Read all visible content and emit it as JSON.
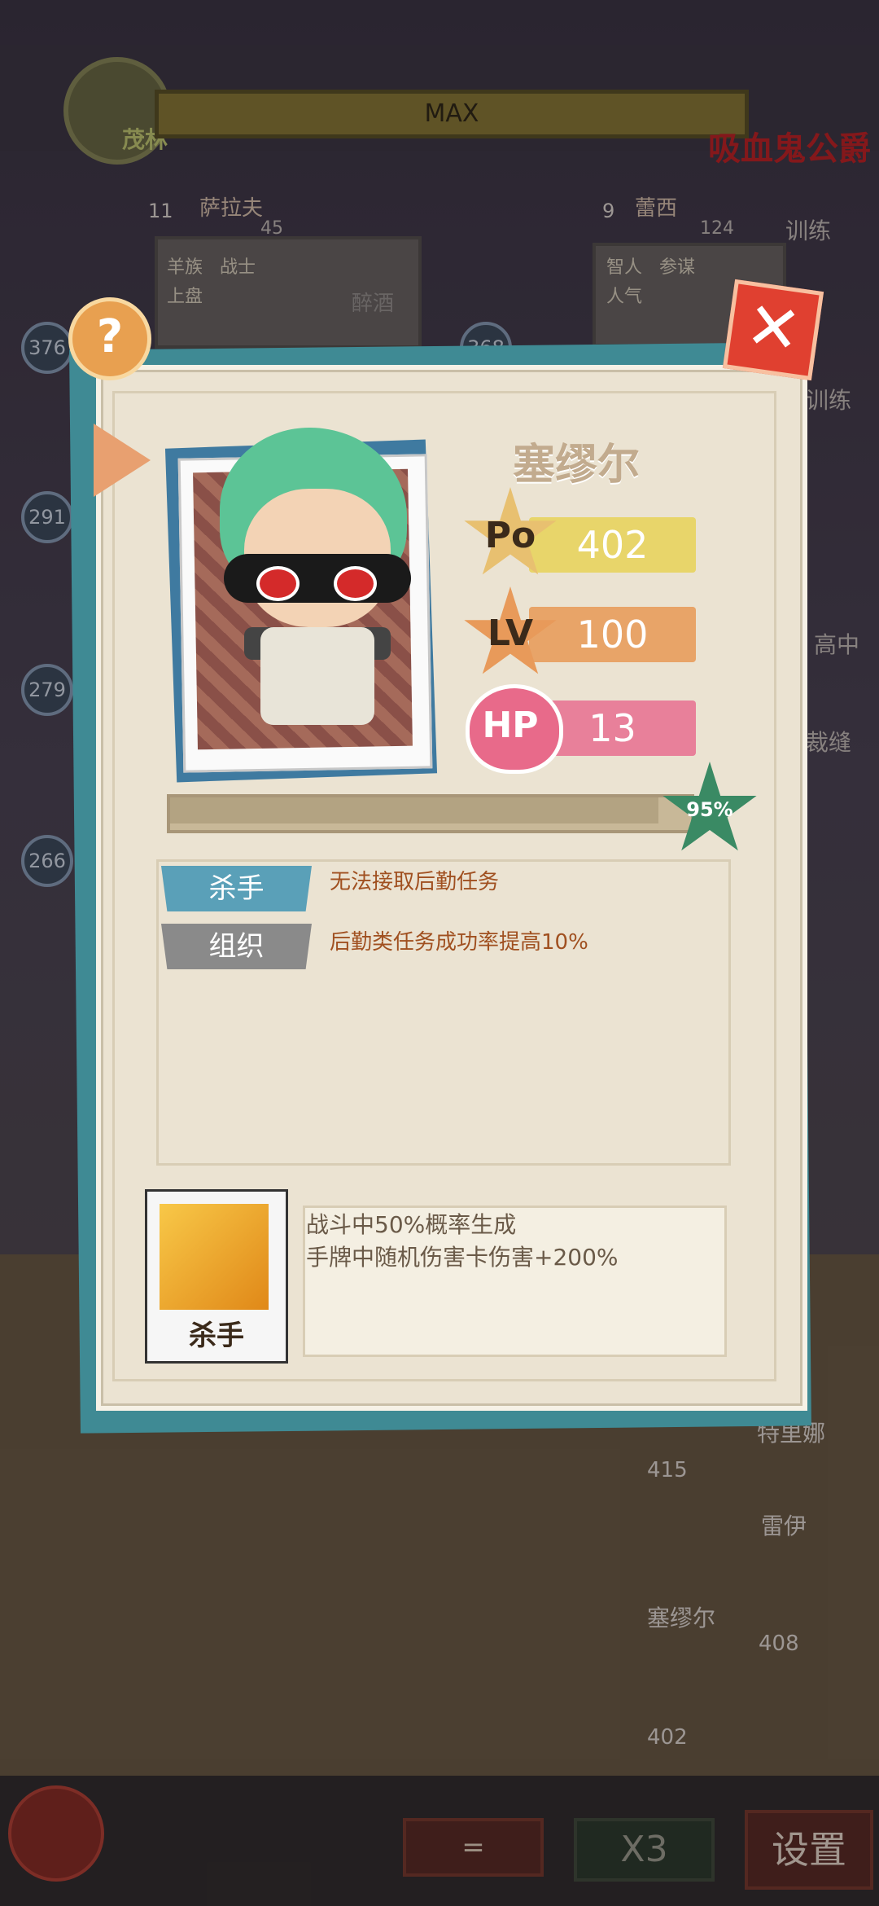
{
  "background": {
    "faction_name": "茂林",
    "level_label": "MAX",
    "boss_name": "吸血鬼公爵",
    "left_cards": [
      {
        "name": "萨拉夫",
        "hearts": "11",
        "hp_value": "45",
        "tags": [
          "羊族",
          "战士"
        ],
        "status": "上盘",
        "action": "醉酒",
        "power": "376"
      },
      {
        "name": "蕾西",
        "hearts": "9",
        "hp_value": "124",
        "tags": [
          "智人",
          "参谋"
        ],
        "status": "人气",
        "action": "训练",
        "power": "368"
      }
    ],
    "side_circles": [
      "291",
      "279",
      "266"
    ],
    "right_labels": [
      "训练",
      "高中",
      "裁缝"
    ],
    "team": [
      {
        "name": "特里娜",
        "power": "415"
      },
      {
        "name": "雷伊",
        "power": "408"
      },
      {
        "name": "塞缪尔",
        "power": "402"
      }
    ],
    "bottom_buttons": {
      "menu": "=",
      "speed": "X3",
      "settings": "设置"
    }
  },
  "dialog": {
    "help_symbol": "?",
    "close_symbol": "✕",
    "character_name": "塞缪尔",
    "stats": {
      "po_label": "Po",
      "po_value": "402",
      "lv_label": "LV",
      "lv_value": "100",
      "hp_label": "HP",
      "hp_value": "13"
    },
    "progress_percent": "95%",
    "traits": [
      {
        "tag": "杀手",
        "desc": "无法接取后勤任务",
        "color": "#5aa0b8"
      },
      {
        "tag": "组织",
        "desc": "后勤类任务成功率提高10%",
        "color": "#8a8a8a"
      }
    ],
    "skill": {
      "name": "杀手",
      "lines": [
        "战斗中50%概率生成",
        "手牌中随机伤害卡伤害+200%"
      ]
    }
  }
}
